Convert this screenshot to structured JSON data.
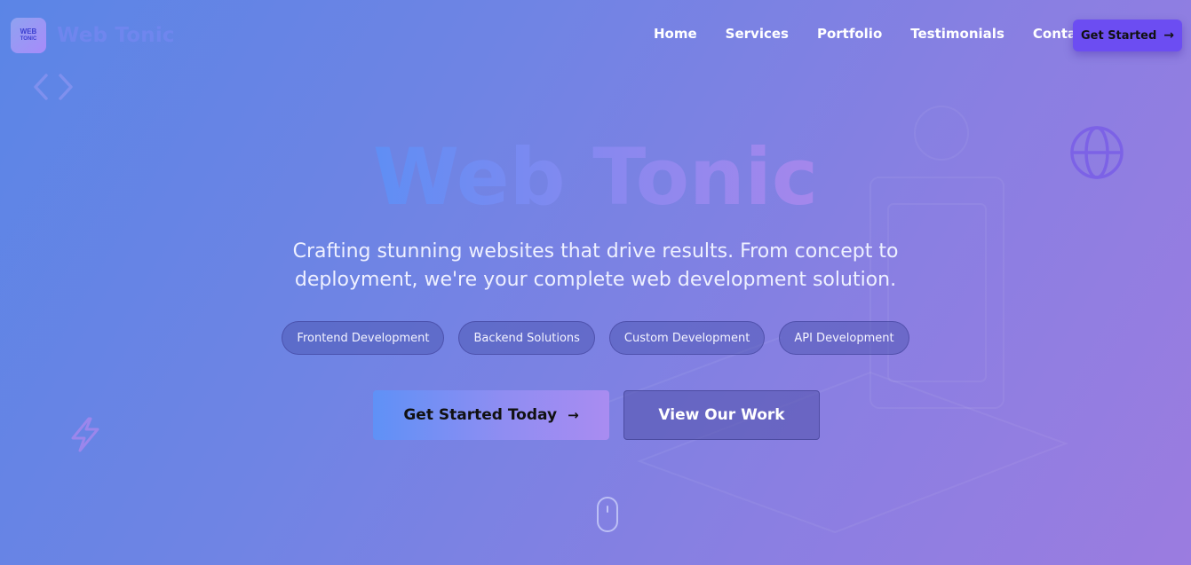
{
  "brand": {
    "badge_line1": "WEB",
    "badge_line2": "TONIC",
    "name": "Web Tonic"
  },
  "nav": {
    "items": [
      "Home",
      "Services",
      "Portfolio",
      "Testimonials",
      "Contact"
    ],
    "cta_label": "Get Started",
    "cta_icon": "arrow-right-icon"
  },
  "hero": {
    "title": "Web Tonic",
    "subtitle": "Crafting stunning websites that drive results. From concept to deployment, we're your complete web development solution.",
    "tags": [
      "Frontend Development",
      "Backend Solutions",
      "Custom Development",
      "API Development"
    ],
    "primary_button": "Get Started Today",
    "primary_icon": "arrow-right-icon",
    "secondary_button": "View Our Work"
  },
  "decor": {
    "icons": [
      "code-brackets-icon",
      "globe-icon",
      "lightning-icon",
      "mouse-scroll-icon"
    ]
  },
  "colors": {
    "bg_start": "#5b85e6",
    "bg_end": "#9b7ce0",
    "accent": "#6c4df2"
  }
}
